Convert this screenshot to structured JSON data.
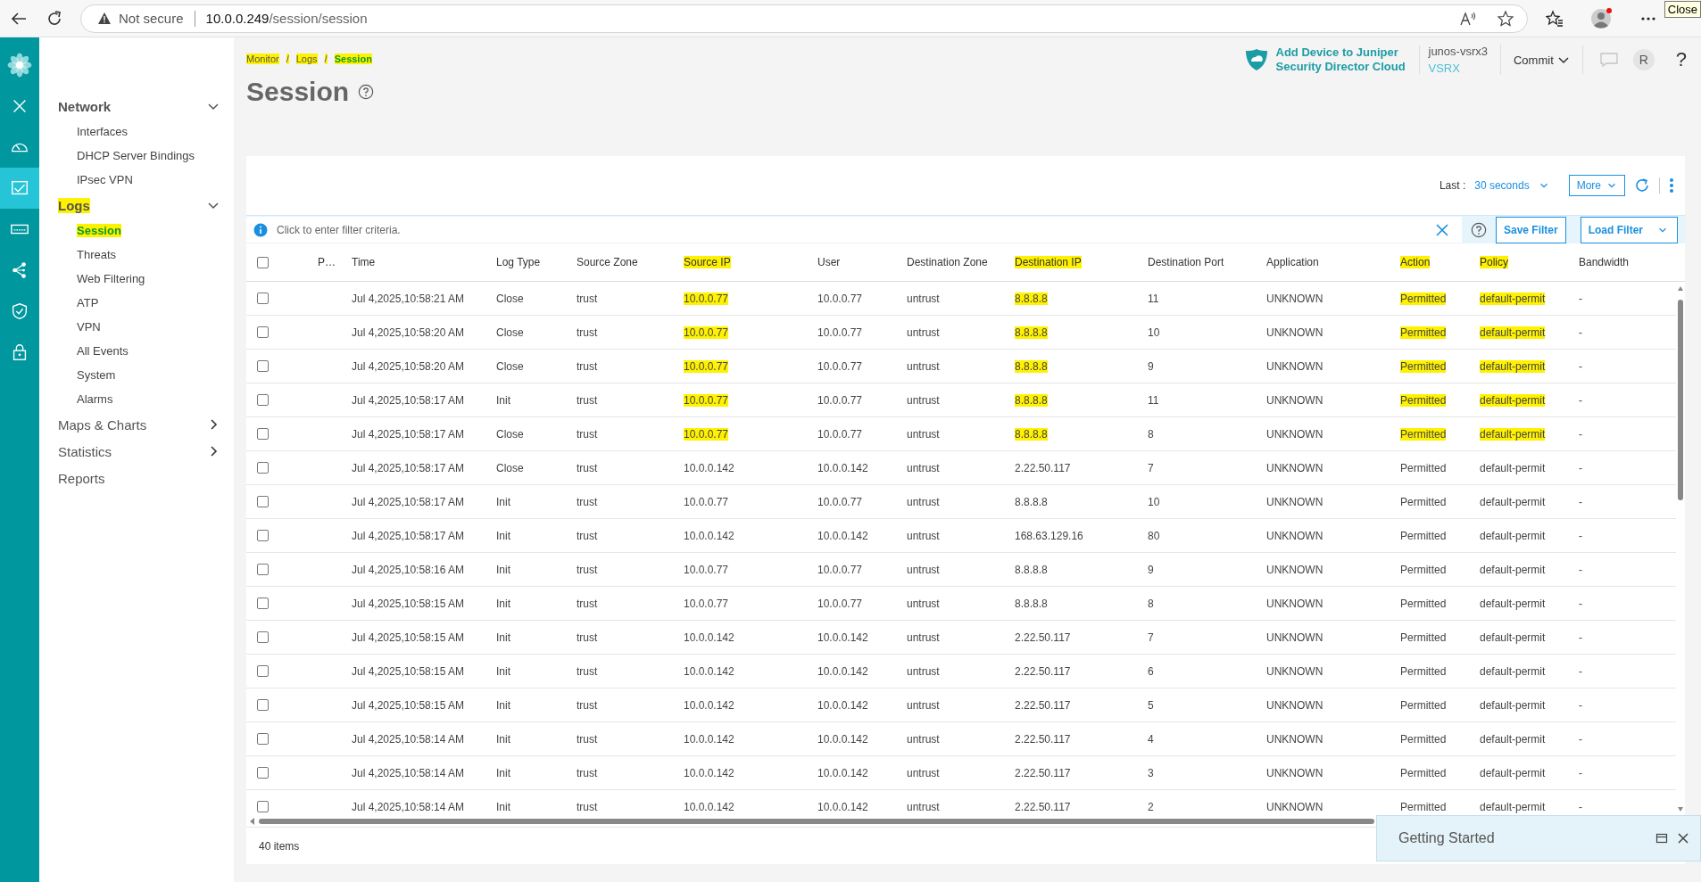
{
  "browser": {
    "security": "Not secure",
    "url_host": "10.0.0.249",
    "url_path": "/session/session",
    "tooltip": "Close"
  },
  "rail": [
    {
      "kind": "logo",
      "selected": false
    },
    {
      "kind": "close",
      "selected": false
    },
    {
      "kind": "gauge",
      "selected": false
    },
    {
      "kind": "monitor",
      "selected": true
    },
    {
      "kind": "device",
      "selected": false
    },
    {
      "kind": "share",
      "selected": false
    },
    {
      "kind": "shield",
      "selected": false
    },
    {
      "kind": "lock",
      "selected": false
    }
  ],
  "sidebar": [
    {
      "kind": "folder",
      "label": "Network",
      "expanded": true,
      "highlighted": false,
      "items": [
        {
          "label": "Interfaces",
          "selected": false,
          "highlighted": false
        },
        {
          "label": "DHCP Server Bindings",
          "selected": false,
          "highlighted": false
        },
        {
          "label": "IPsec VPN",
          "selected": false,
          "highlighted": false
        }
      ]
    },
    {
      "kind": "folder",
      "label": "Logs",
      "expanded": true,
      "highlighted": true,
      "items": [
        {
          "label": "Session",
          "selected": true,
          "highlighted": true
        },
        {
          "label": "Threats",
          "selected": false,
          "highlighted": false
        },
        {
          "label": "Web Filtering",
          "selected": false,
          "highlighted": false
        },
        {
          "label": "ATP",
          "selected": false,
          "highlighted": false
        },
        {
          "label": "VPN",
          "selected": false,
          "highlighted": false
        },
        {
          "label": "All Events",
          "selected": false,
          "highlighted": false
        },
        {
          "label": "System",
          "selected": false,
          "highlighted": false
        },
        {
          "label": "Alarms",
          "selected": false,
          "highlighted": false
        }
      ]
    },
    {
      "kind": "folder",
      "label": "Maps & Charts",
      "expanded": false,
      "highlighted": false
    },
    {
      "kind": "folder",
      "label": "Statistics",
      "expanded": false,
      "highlighted": false
    },
    {
      "kind": "link",
      "label": "Reports",
      "highlighted": false
    }
  ],
  "header": {
    "cloud_link": "Add Device to Juniper Security Director Cloud",
    "device_name": "junos-vsrx3",
    "device_model": "VSRX",
    "commit": "Commit",
    "avatar": "R",
    "help": "?"
  },
  "breadcrumb_separator": "/",
  "breadcrumb": [
    {
      "label": "Monitor",
      "current": false,
      "highlighted": true
    },
    {
      "label": "Logs",
      "current": false,
      "highlighted": true
    },
    {
      "label": "Session",
      "current": true,
      "highlighted": true
    }
  ],
  "title": "Session",
  "toolbar": {
    "last_label": "Last :",
    "last_value": "30 seconds",
    "more": "More"
  },
  "filter": {
    "placeholder": "Click to enter filter criteria.",
    "save": "Save Filter",
    "load": "Load Filter"
  },
  "table": {
    "select_all_checked": false,
    "columns": [
      {
        "label": "P…",
        "highlighted": false
      },
      {
        "label": "Time",
        "highlighted": false
      },
      {
        "label": "Log Type",
        "highlighted": false
      },
      {
        "label": "Source Zone",
        "highlighted": false
      },
      {
        "label": "Source IP",
        "highlighted": true
      },
      {
        "label": "User",
        "highlighted": false
      },
      {
        "label": "Destination Zone",
        "highlighted": false
      },
      {
        "label": "Destination IP",
        "highlighted": true
      },
      {
        "label": "Destination Port",
        "highlighted": false
      },
      {
        "label": "Application",
        "highlighted": false
      },
      {
        "label": "Action",
        "highlighted": true
      },
      {
        "label": "Policy",
        "highlighted": true
      },
      {
        "label": "Bandwidth",
        "highlighted": false
      }
    ],
    "rows": [
      {
        "checked": false,
        "highlighted": true,
        "cells": [
          "",
          "Jul 4,2025,10:58:21 AM",
          "Close",
          "trust",
          "10.0.0.77",
          "10.0.0.77",
          "untrust",
          "8.8.8.8",
          "11",
          "UNKNOWN",
          "Permitted",
          "default-permit",
          "-"
        ]
      },
      {
        "checked": false,
        "highlighted": true,
        "cells": [
          "",
          "Jul 4,2025,10:58:20 AM",
          "Close",
          "trust",
          "10.0.0.77",
          "10.0.0.77",
          "untrust",
          "8.8.8.8",
          "10",
          "UNKNOWN",
          "Permitted",
          "default-permit",
          "-"
        ]
      },
      {
        "checked": false,
        "highlighted": true,
        "cells": [
          "",
          "Jul 4,2025,10:58:20 AM",
          "Close",
          "trust",
          "10.0.0.77",
          "10.0.0.77",
          "untrust",
          "8.8.8.8",
          "9",
          "UNKNOWN",
          "Permitted",
          "default-permit",
          "-"
        ]
      },
      {
        "checked": false,
        "highlighted": true,
        "cells": [
          "",
          "Jul 4,2025,10:58:17 AM",
          "Init",
          "trust",
          "10.0.0.77",
          "10.0.0.77",
          "untrust",
          "8.8.8.8",
          "11",
          "UNKNOWN",
          "Permitted",
          "default-permit",
          "-"
        ]
      },
      {
        "checked": false,
        "highlighted": true,
        "cells": [
          "",
          "Jul 4,2025,10:58:17 AM",
          "Close",
          "trust",
          "10.0.0.77",
          "10.0.0.77",
          "untrust",
          "8.8.8.8",
          "8",
          "UNKNOWN",
          "Permitted",
          "default-permit",
          "-"
        ]
      },
      {
        "checked": false,
        "highlighted": false,
        "cells": [
          "",
          "Jul 4,2025,10:58:17 AM",
          "Close",
          "trust",
          "10.0.0.142",
          "10.0.0.142",
          "untrust",
          "2.22.50.117",
          "7",
          "UNKNOWN",
          "Permitted",
          "default-permit",
          "-"
        ]
      },
      {
        "checked": false,
        "highlighted": false,
        "cells": [
          "",
          "Jul 4,2025,10:58:17 AM",
          "Init",
          "trust",
          "10.0.0.77",
          "10.0.0.77",
          "untrust",
          "8.8.8.8",
          "10",
          "UNKNOWN",
          "Permitted",
          "default-permit",
          "-"
        ]
      },
      {
        "checked": false,
        "highlighted": false,
        "cells": [
          "",
          "Jul 4,2025,10:58:17 AM",
          "Init",
          "trust",
          "10.0.0.142",
          "10.0.0.142",
          "untrust",
          "168.63.129.16",
          "80",
          "UNKNOWN",
          "Permitted",
          "default-permit",
          "-"
        ]
      },
      {
        "checked": false,
        "highlighted": false,
        "cells": [
          "",
          "Jul 4,2025,10:58:16 AM",
          "Init",
          "trust",
          "10.0.0.77",
          "10.0.0.77",
          "untrust",
          "8.8.8.8",
          "9",
          "UNKNOWN",
          "Permitted",
          "default-permit",
          "-"
        ]
      },
      {
        "checked": false,
        "highlighted": false,
        "cells": [
          "",
          "Jul 4,2025,10:58:15 AM",
          "Init",
          "trust",
          "10.0.0.77",
          "10.0.0.77",
          "untrust",
          "8.8.8.8",
          "8",
          "UNKNOWN",
          "Permitted",
          "default-permit",
          "-"
        ]
      },
      {
        "checked": false,
        "highlighted": false,
        "cells": [
          "",
          "Jul 4,2025,10:58:15 AM",
          "Init",
          "trust",
          "10.0.0.142",
          "10.0.0.142",
          "untrust",
          "2.22.50.117",
          "7",
          "UNKNOWN",
          "Permitted",
          "default-permit",
          "-"
        ]
      },
      {
        "checked": false,
        "highlighted": false,
        "cells": [
          "",
          "Jul 4,2025,10:58:15 AM",
          "Init",
          "trust",
          "10.0.0.142",
          "10.0.0.142",
          "untrust",
          "2.22.50.117",
          "6",
          "UNKNOWN",
          "Permitted",
          "default-permit",
          "-"
        ]
      },
      {
        "checked": false,
        "highlighted": false,
        "cells": [
          "",
          "Jul 4,2025,10:58:15 AM",
          "Init",
          "trust",
          "10.0.0.142",
          "10.0.0.142",
          "untrust",
          "2.22.50.117",
          "5",
          "UNKNOWN",
          "Permitted",
          "default-permit",
          "-"
        ]
      },
      {
        "checked": false,
        "highlighted": false,
        "cells": [
          "",
          "Jul 4,2025,10:58:14 AM",
          "Init",
          "trust",
          "10.0.0.142",
          "10.0.0.142",
          "untrust",
          "2.22.50.117",
          "4",
          "UNKNOWN",
          "Permitted",
          "default-permit",
          "-"
        ]
      },
      {
        "checked": false,
        "highlighted": false,
        "cells": [
          "",
          "Jul 4,2025,10:58:14 AM",
          "Init",
          "trust",
          "10.0.0.142",
          "10.0.0.142",
          "untrust",
          "2.22.50.117",
          "3",
          "UNKNOWN",
          "Permitted",
          "default-permit",
          "-"
        ]
      },
      {
        "checked": false,
        "highlighted": false,
        "cells": [
          "",
          "Jul 4,2025,10:58:14 AM",
          "Init",
          "trust",
          "10.0.0.142",
          "10.0.0.142",
          "untrust",
          "2.22.50.117",
          "2",
          "UNKNOWN",
          "Permitted",
          "default-permit",
          "-"
        ]
      }
    ]
  },
  "footer": {
    "count": "40 items"
  },
  "popup": {
    "title": "Getting Started"
  }
}
